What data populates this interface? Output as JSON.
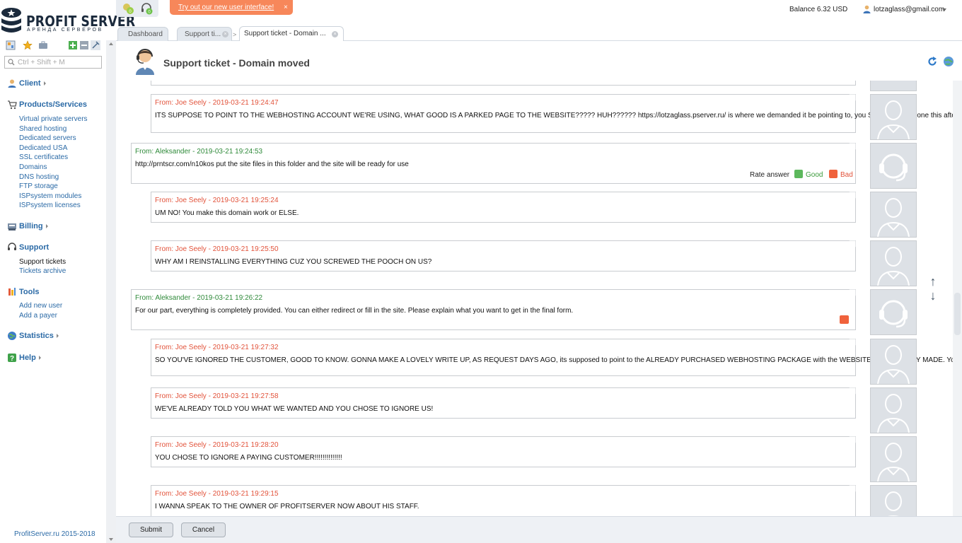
{
  "app": {
    "logo_title": "PROFIT SERVER",
    "logo_sub": "АРЕНДА СЕРВЕРОВ",
    "copyright": "ProfitServer.ru 2015-2018"
  },
  "search": {
    "placeholder": "Ctrl + Shift + M"
  },
  "top": {
    "promo_text": "Try out our new user interface!",
    "promo_close": "×",
    "balance": "Balance 6.32 USD",
    "user_email": "lotzaglass@gmail.com"
  },
  "tabs": [
    {
      "label": "Dashboard"
    },
    {
      "label": "Support ti..."
    },
    {
      "label": "Support ticket - Domain ..."
    }
  ],
  "sidebar": {
    "client": "Client",
    "products": {
      "title": "Products/Services",
      "items": [
        "Virtual private servers",
        "Shared hosting",
        "Dedicated servers",
        "Dedicated USA",
        "SSL certificates",
        "Domains",
        "DNS hosting",
        "FTP storage",
        "ISPsystem modules",
        "ISPsystem licenses"
      ]
    },
    "billing": "Billing",
    "support": {
      "title": "Support",
      "items": [
        "Support tickets",
        "Tickets archive"
      ]
    },
    "tools": {
      "title": "Tools",
      "items": [
        "Add new user",
        "Add a payer"
      ]
    },
    "statistics": "Statistics",
    "help": "Help"
  },
  "page": {
    "title": "Support ticket - Domain moved"
  },
  "messages": [
    {
      "from": "From: Joe Seely - 2019-03-21 19:24:47",
      "body": "ITS SUPPOSE TO POINT TO THE WEBHOSTING ACCOUNT WE'RE USING, WHAT GOOD IS A PARKED PAGE TO THE WEBSITE????? HUH?????? https://lotzaglass.pserver.ru/ is where we demanded it be pointing to, you STILL haven't done this after DAYS of making us wait and we're beyond pissed off at this point now with the lip service we've been receiving from you. Now fix it already or a paypal claims gonna happen."
    },
    {
      "from": "From: Aleksander - 2019-03-21 19:24:53",
      "body": "http://prntscr.com/n10kos put the site files in this folder and the site will be ready for use"
    },
    {
      "from": "From: Joe Seely - 2019-03-21 19:25:24",
      "body": "UM NO! You make this domain work or ELSE."
    },
    {
      "from": "From: Joe Seely - 2019-03-21 19:25:50",
      "body": "WHY AM I REINSTALLING EVERYTHING CUZ YOU SCREWED THE POOCH ON US?"
    },
    {
      "from": "From: Aleksander - 2019-03-21 19:26:22",
      "body": "For our part, everything is completely provided. You can either redirect or fill in the site. Please explain what you want to get in the final form."
    },
    {
      "from": "From: Joe Seely - 2019-03-21 19:27:32",
      "body": "SO YOU'VE IGNORED THE CUSTOMER, GOOD TO KNOW. GONNA MAKE A LOVELY WRITE UP, AS REQUEST DAYS AGO, its supposed to point to the ALREADY PURCHASED WEBHOSTING PACKAGE with the WEBSITE I'VE ALREADY MADE. You literally did NOTHING, and left YOUR customer hanging."
    },
    {
      "from": "From: Joe Seely - 2019-03-21 19:27:58",
      "body": "WE'VE ALREADY TOLD YOU WHAT WE WANTED AND YOU CHOSE TO IGNORE US!"
    },
    {
      "from": "From: Joe Seely - 2019-03-21 19:28:20",
      "body": "YOU CHOSE TO IGNORE A PAYING CUSTOMER!!!!!!!!!!!!!!"
    },
    {
      "from": "From: Joe Seely - 2019-03-21 19:29:15",
      "body": "I WANNA SPEAK TO THE OWNER OF PROFITSERVER NOW ABOUT HIS STAFF."
    }
  ],
  "rating": {
    "label": "Rate answer",
    "good": "Good",
    "bad": "Bad"
  },
  "buttons": {
    "submit": "Submit",
    "cancel": "Cancel"
  },
  "colors": {
    "user_from": "#e2533b",
    "staff_from": "#2f8a3a",
    "link": "#2b6aa6",
    "promo": "#f7875a"
  }
}
